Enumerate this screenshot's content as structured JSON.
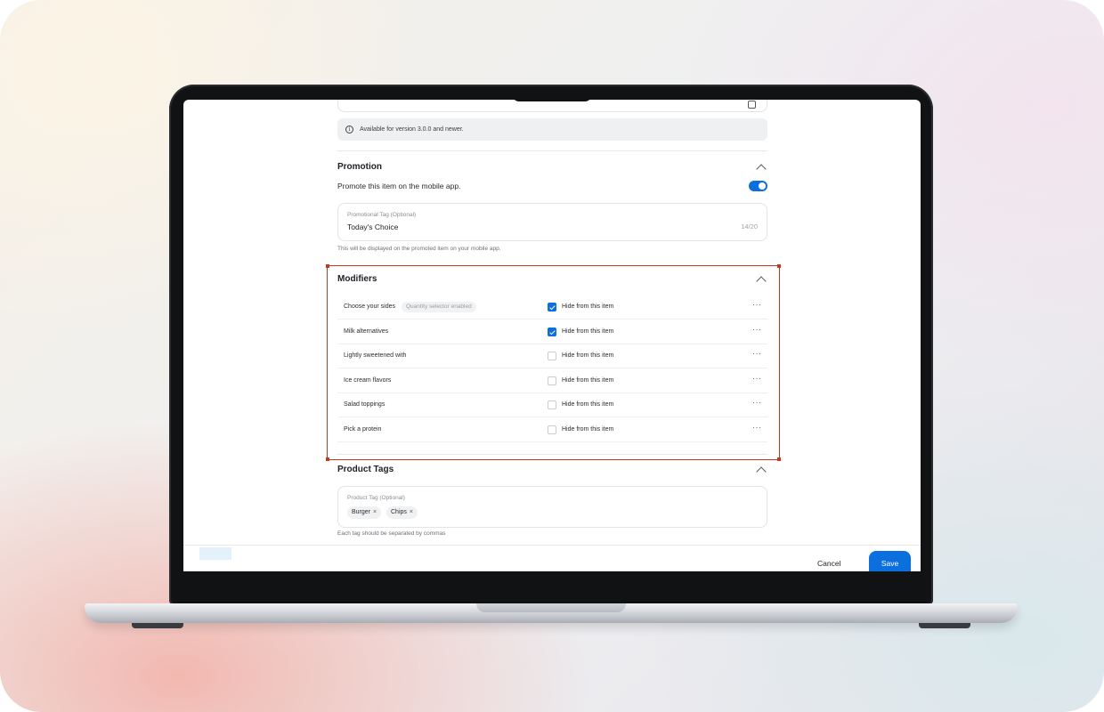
{
  "info": {
    "text": "Available for version 3.0.0 and newer."
  },
  "promotion": {
    "title": "Promotion",
    "toggle_label": "Promote this item on the mobile app.",
    "toggle_on": true,
    "field_label": "Promotional Tag (Optional)",
    "field_value": "Today's Choice",
    "counter": "14/20",
    "helper": "This will be displayed on the promoted item on your mobile app."
  },
  "modifiers": {
    "title": "Modifiers",
    "checkbox_label": "Hide from this item",
    "more_label": "···",
    "rows": [
      {
        "name": "Choose your sides",
        "badge": "Quantity selector enabled",
        "checked": true
      },
      {
        "name": "Milk alternatives",
        "badge": "",
        "checked": true
      },
      {
        "name": "Lightly sweetened with",
        "badge": "",
        "checked": false
      },
      {
        "name": "Ice cream flavors",
        "badge": "",
        "checked": false
      },
      {
        "name": "Salad toppings",
        "badge": "",
        "checked": false
      },
      {
        "name": "Pick a protein",
        "badge": "",
        "checked": false
      }
    ]
  },
  "product_tags": {
    "title": "Product Tags",
    "field_label": "Product Tag (Optional)",
    "tags": [
      "Burger",
      "Chips"
    ],
    "remove_glyph": "×",
    "helper": "Each tag should be separated by commas"
  },
  "footer": {
    "cancel_label": "Cancel",
    "save_label": "Save"
  },
  "colors": {
    "accent": "#0b6fde",
    "selection": "#c4381e"
  }
}
